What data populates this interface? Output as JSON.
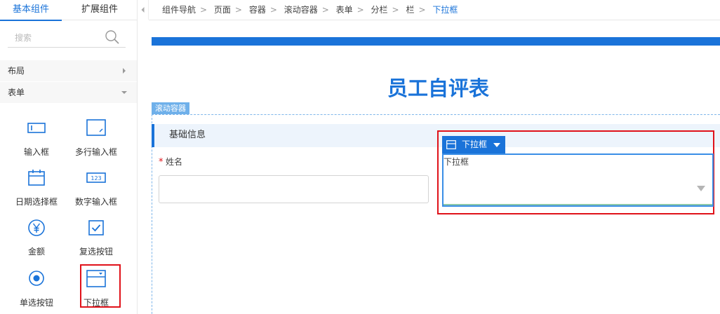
{
  "tabs": {
    "basic": "基本组件",
    "extended": "扩展组件"
  },
  "search": {
    "placeholder": "搜索"
  },
  "groups": {
    "layout": "布局",
    "form": "表单"
  },
  "components": [
    {
      "label": "输入框",
      "icon": "input-box-icon"
    },
    {
      "label": "多行输入框",
      "icon": "textarea-icon"
    },
    {
      "label": "日期选择框",
      "icon": "calendar-icon"
    },
    {
      "label": "数字输入框",
      "icon": "number-input-icon"
    },
    {
      "label": "金额",
      "icon": "yen-icon"
    },
    {
      "label": "复选按钮",
      "icon": "checkbox-icon"
    },
    {
      "label": "单选按钮",
      "icon": "radio-icon"
    },
    {
      "label": "下拉框",
      "icon": "dropdown-icon"
    }
  ],
  "number_icon_text": "123",
  "breadcrumb": [
    "组件导航",
    "页面",
    "容器",
    "滚动容器",
    "表单",
    "分栏",
    "栏",
    "下拉框"
  ],
  "form": {
    "title": "员工自评表",
    "scroll_container_tag": "滚动容器",
    "section_title": "基础信息",
    "required_mark": "*",
    "name_label": "姓名",
    "dropdown_chip": "下拉框",
    "dropdown_label": "下拉框"
  },
  "colors": {
    "accent": "#1a73d9",
    "highlight": "#e0121a",
    "section_bg": "#edf4fc"
  }
}
